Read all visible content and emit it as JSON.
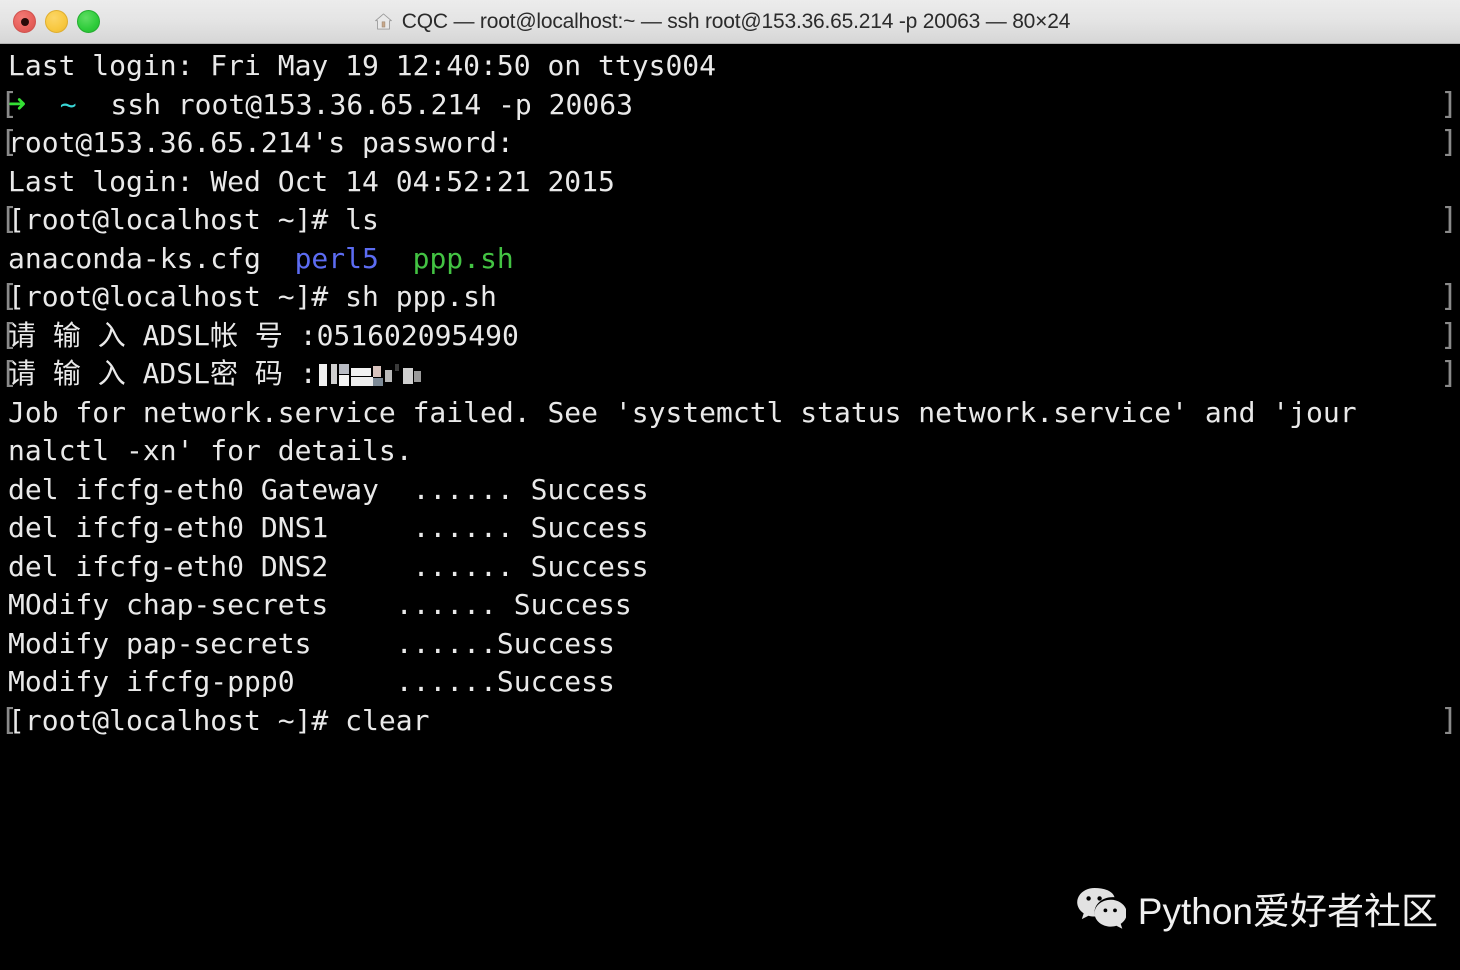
{
  "window": {
    "title": "CQC — root@localhost:~ — ssh root@153.36.65.214 -p 20063 — 80×24",
    "icon": "home-icon",
    "traffic_lights": {
      "close_label": "Close",
      "minimize_label": "Minimize",
      "maximize_label": "Maximize",
      "close_color": "#e8615c",
      "minimize_color": "#f8c83f",
      "maximize_color": "#2ecc3a"
    }
  },
  "terminal": {
    "background_color": "#000000",
    "foreground_color": "#e6e6e6",
    "prompt_mark_color": "#8a8a8a",
    "columns": 80,
    "rows": 24,
    "lines": [
      {
        "id": "line-last-login-local",
        "mark_left": "",
        "mark_right": "",
        "segments": [
          {
            "text": "Last login: Fri May 19 12:40:50 on ttys004",
            "color": "white"
          }
        ]
      },
      {
        "id": "line-ssh-command",
        "mark_left": "[",
        "mark_right": "]",
        "segments": [
          {
            "text": "➜",
            "color": "green"
          },
          {
            "text": "  ",
            "color": "white"
          },
          {
            "text": "~",
            "color": "cyan"
          },
          {
            "text": "  ssh root@153.36.65.214 -p 20063",
            "color": "white"
          }
        ]
      },
      {
        "id": "line-password-prompt",
        "mark_left": "[",
        "mark_right": "]",
        "segments": [
          {
            "text": "root@153.36.65.214's password:",
            "color": "white"
          }
        ]
      },
      {
        "id": "line-last-login-remote",
        "mark_left": "",
        "mark_right": "",
        "segments": [
          {
            "text": "Last login: Wed Oct 14 04:52:21 2015",
            "color": "white"
          }
        ]
      },
      {
        "id": "line-prompt-ls",
        "mark_left": "[",
        "mark_right": "]",
        "segments": [
          {
            "text": "[root@localhost ~]# ls",
            "color": "white"
          }
        ]
      },
      {
        "id": "line-ls-output",
        "mark_left": "",
        "mark_right": "",
        "segments": [
          {
            "text": "anaconda-ks.cfg  ",
            "color": "white"
          },
          {
            "text": "perl5",
            "color": "blue"
          },
          {
            "text": "  ",
            "color": "white"
          },
          {
            "text": "ppp.sh",
            "color": "file-green"
          }
        ]
      },
      {
        "id": "line-prompt-sh-ppp",
        "mark_left": "[",
        "mark_right": "]",
        "segments": [
          {
            "text": "[root@localhost ~]# sh ppp.sh",
            "color": "white"
          }
        ]
      },
      {
        "id": "line-adsl-account",
        "mark_left": "[",
        "mark_right": "]",
        "segments": [
          {
            "text": "请 输 入 ADSL帐 号 :051602095490",
            "color": "white"
          }
        ]
      },
      {
        "id": "line-adsl-password",
        "mark_left": "[",
        "mark_right": "]",
        "segments": [
          {
            "text": "请 输 入 ADSL密 码 :",
            "color": "white"
          },
          {
            "text": "",
            "color": "redacted"
          }
        ]
      },
      {
        "id": "line-job-failed-1",
        "mark_left": "",
        "mark_right": "",
        "segments": [
          {
            "text": "Job for network.service failed. See 'systemctl status network.service' and 'jour",
            "color": "white"
          }
        ]
      },
      {
        "id": "line-job-failed-2",
        "mark_left": "",
        "mark_right": "",
        "segments": [
          {
            "text": "nalctl -xn' for details.",
            "color": "white"
          }
        ]
      },
      {
        "id": "line-del-gateway",
        "mark_left": "",
        "mark_right": "",
        "segments": [
          {
            "text": "del ifcfg-eth0 Gateway  ...... Success",
            "color": "white"
          }
        ]
      },
      {
        "id": "line-del-dns1",
        "mark_left": "",
        "mark_right": "",
        "segments": [
          {
            "text": "del ifcfg-eth0 DNS1     ...... Success",
            "color": "white"
          }
        ]
      },
      {
        "id": "line-del-dns2",
        "mark_left": "",
        "mark_right": "",
        "segments": [
          {
            "text": "del ifcfg-eth0 DNS2     ...... Success",
            "color": "white"
          }
        ]
      },
      {
        "id": "line-modify-chap-secrets",
        "mark_left": "",
        "mark_right": "",
        "segments": [
          {
            "text": "MOdify chap-secrets    ...... Success",
            "color": "white"
          }
        ]
      },
      {
        "id": "line-modify-pap-secrets",
        "mark_left": "",
        "mark_right": "",
        "segments": [
          {
            "text": "Modify pap-secrets     ......Success",
            "color": "white"
          }
        ]
      },
      {
        "id": "line-modify-ifcfg-ppp0",
        "mark_left": "",
        "mark_right": "",
        "segments": [
          {
            "text": "Modify ifcfg-ppp0      ......Success",
            "color": "white"
          }
        ]
      },
      {
        "id": "line-prompt-clear",
        "mark_left": "[",
        "mark_right": "]",
        "segments": [
          {
            "text": "[root@localhost ~]# clear",
            "color": "white"
          }
        ]
      }
    ]
  },
  "watermark": {
    "icon": "wechat-icon",
    "text": "Python爱好者社区",
    "color": "#f0f0f0"
  }
}
